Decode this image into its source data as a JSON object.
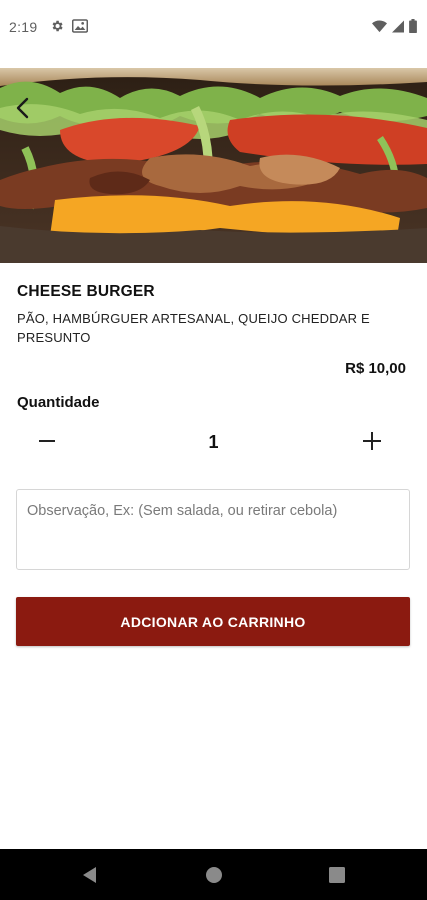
{
  "status_bar": {
    "time": "2:19",
    "icons": [
      "settings-gear-icon",
      "image-notification-icon",
      "wifi-icon",
      "cell-signal-icon",
      "battery-icon"
    ]
  },
  "hero": {
    "image": "cheese-burger-photo",
    "back_icon": "chevron-left-icon"
  },
  "product": {
    "name": "CHEESE BURGER",
    "description": "PÃO, HAMBÚRGUER ARTESANAL, QUEIJO CHEDDAR E PRESUNTO",
    "price": "R$ 10,00"
  },
  "quantity": {
    "label": "Quantidade",
    "value": "1",
    "decrement_icon": "minus-icon",
    "increment_icon": "plus-icon"
  },
  "observation": {
    "placeholder": "Observação, Ex: (Sem salada, ou retirar cebola)",
    "value": ""
  },
  "add_to_cart": {
    "label": "ADCIONAR AO CARRINHO"
  },
  "nav_bar": {
    "icons": [
      "nav-back-icon",
      "nav-home-icon",
      "nav-recents-icon"
    ]
  },
  "colors": {
    "accent": "#8b1a10",
    "nav_bar": "#000000",
    "field_border": "#d6d6d6"
  }
}
